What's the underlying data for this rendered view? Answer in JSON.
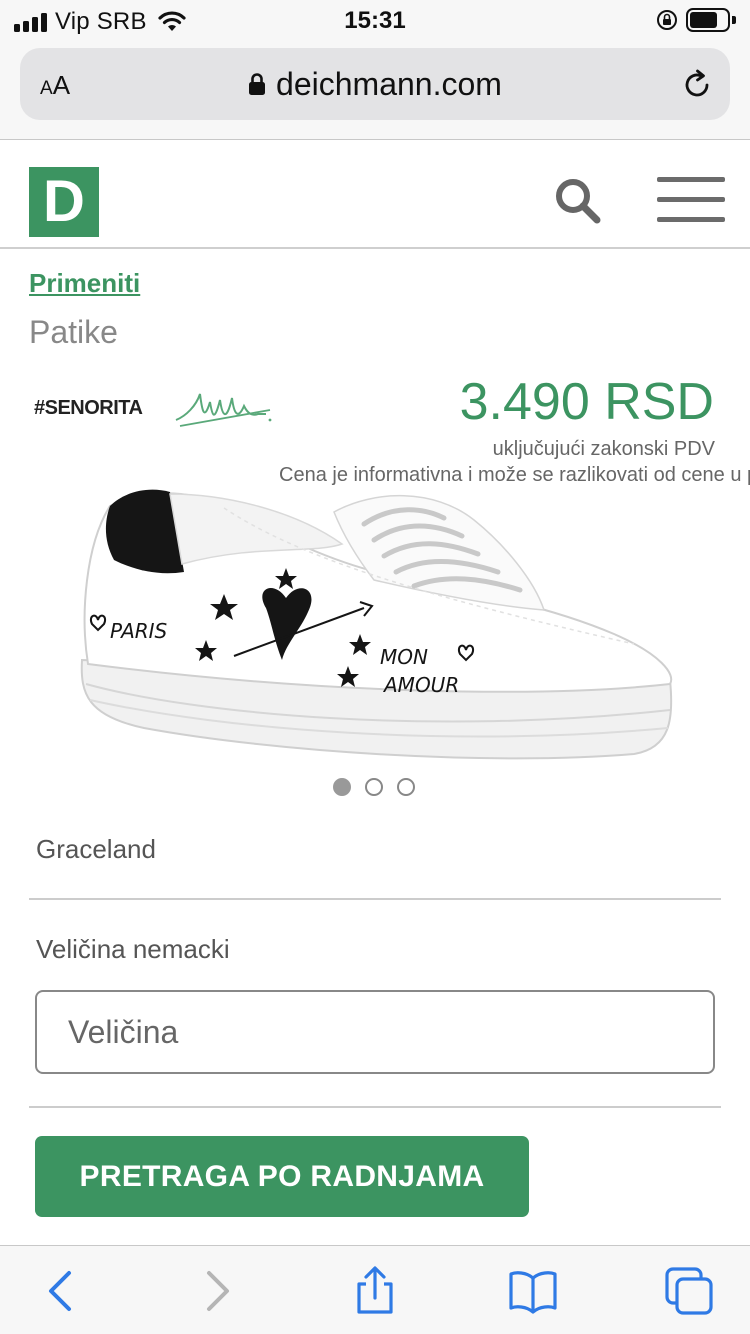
{
  "status_bar": {
    "carrier": "Vip SRB",
    "time": "15:31",
    "signal_bars": 4,
    "icons": [
      "signal-icon",
      "wifi-icon",
      "orientation-lock-icon",
      "battery-icon"
    ]
  },
  "browser": {
    "text_size_label": "AA",
    "url": "deichmann.com",
    "icons": [
      "lock-icon",
      "reload-icon"
    ]
  },
  "site_header": {
    "logo_letter": "D",
    "brand_color": "#3c9461",
    "icons": [
      "search-icon",
      "menu-icon"
    ]
  },
  "product": {
    "breadcrumb": "Primeniti",
    "category": "Patike",
    "brand": "#SENORITA",
    "price": "3.490 RSD",
    "vat_note": "uključujući zakonski PDV",
    "price_note": "Cena je informativna i može se razlikovati od cene u prodavnici",
    "image_text": [
      "PARIS",
      "MON",
      "AMOUR"
    ],
    "carousel_total": 3,
    "carousel_active": 1,
    "name": "Graceland",
    "size_label": "Veličina nemacki",
    "size_placeholder": "Veličina",
    "store_button": "PRETRAGA PO RADNJAMA"
  },
  "toolbar": {
    "accent_color": "#2f7ae5",
    "icons": [
      "back-icon",
      "forward-icon",
      "share-icon",
      "bookmarks-icon",
      "tabs-icon"
    ]
  }
}
